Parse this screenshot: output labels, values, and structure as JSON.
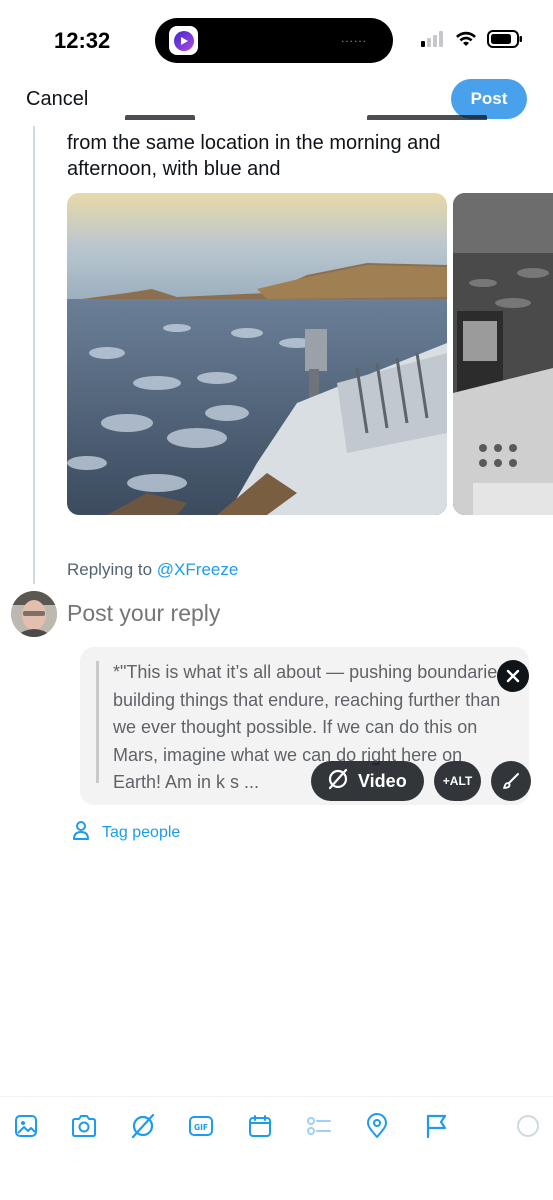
{
  "status_bar": {
    "time": "12:32",
    "island_dots": "......"
  },
  "header": {
    "cancel_label": "Cancel",
    "post_label": "Post"
  },
  "quoted_post": {
    "text_partial_top": "from the same location in the morning and",
    "text_line_2": "afternoon, with blue and",
    "images": [
      {
        "alt": "Mars rover panorama in color"
      },
      {
        "alt": "Mars rover panorama in grayscale"
      }
    ]
  },
  "reply": {
    "replying_prefix": "Replying to",
    "replying_handle": "@XFreeze",
    "placeholder": "Post your reply"
  },
  "attachment": {
    "text": "*\"This is what it’s all about — pushing boundaries, building things that endure, reaching further than we ever thought possible. If we can do this on Mars, imagine what we can do right here on Earth! Am  in  k  s  ...",
    "video_label": "Video",
    "alt_label": "+ALT"
  },
  "tag_people_label": "Tag people",
  "toolbar": {
    "icons": [
      "image-icon",
      "camera-icon",
      "grok-icon",
      "gif-icon",
      "schedule-icon",
      "poll-icon",
      "location-icon",
      "flag-icon",
      "char-counter-icon"
    ]
  },
  "colors": {
    "accent": "#1d9bf0",
    "post_button": "#4aa1eb",
    "muted": "#536471"
  }
}
